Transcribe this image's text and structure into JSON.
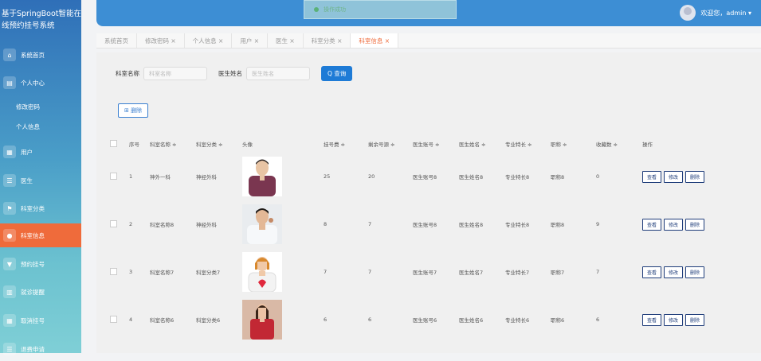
{
  "sidebar": {
    "brand": "基于SpringBoot智能在线预约挂号系统",
    "items": [
      {
        "label": "系统首页",
        "icon": "home-icon"
      },
      {
        "label": "个人中心",
        "icon": "user-card-icon"
      },
      {
        "label": "用户",
        "icon": "grid-icon"
      },
      {
        "label": "医生",
        "icon": "list-icon"
      },
      {
        "label": "科室分类",
        "icon": "flag-icon"
      },
      {
        "label": "科室信息",
        "icon": "pin-icon"
      },
      {
        "label": "预约挂号",
        "icon": "form-icon"
      },
      {
        "label": "就诊提醒",
        "icon": "chart-icon"
      },
      {
        "label": "取消挂号",
        "icon": "grid-icon"
      },
      {
        "label": "退费申请",
        "icon": "list-icon"
      }
    ],
    "subitems": [
      "修改密码",
      "个人信息"
    ]
  },
  "toast": {
    "text": "操作成功"
  },
  "header": {
    "welcome": "欢迎您，admin ▾"
  },
  "tabs": [
    "系统首页",
    "修改密码 ×",
    "个人信息 ×",
    "用户 ×",
    "医生 ×",
    "科室分类 ×",
    "科室信息 ×"
  ],
  "search": {
    "dept_label": "科室名称",
    "dept_placeholder": "科室名称",
    "doctor_label": "医生姓名",
    "doctor_placeholder": "医生姓名",
    "query_button": "Q 查询"
  },
  "delete_button": "⊞ 删除",
  "table": {
    "headers": [
      "序号",
      "科室名称 ≑",
      "科室分类 ≑",
      "头像",
      "挂号费 ≑",
      "剩余号源 ≑",
      "医生账号 ≑",
      "医生姓名 ≑",
      "专业特长 ≑",
      "职称 ≑",
      "收藏数 ≑",
      "操作"
    ],
    "rows": [
      {
        "no": "1",
        "dept": "神外一科",
        "category": "神经外科",
        "fee": "25",
        "remaining": "20",
        "account": "医生账号8",
        "name": "医生姓名8",
        "specialty": "专业特长8",
        "title": "职称8",
        "favorites": "0"
      },
      {
        "no": "2",
        "dept": "科室名称8",
        "category": "神经外科",
        "fee": "8",
        "remaining": "7",
        "account": "医生账号8",
        "name": "医生姓名8",
        "specialty": "专业特长8",
        "title": "职称8",
        "favorites": "9"
      },
      {
        "no": "3",
        "dept": "科室名称7",
        "category": "科室分类7",
        "fee": "7",
        "remaining": "7",
        "account": "医生账号7",
        "name": "医生姓名7",
        "specialty": "专业特长7",
        "title": "职称7",
        "favorites": "7"
      },
      {
        "no": "4",
        "dept": "科室名称6",
        "category": "科室分类6",
        "fee": "6",
        "remaining": "6",
        "account": "医生账号6",
        "name": "医生姓名6",
        "specialty": "专业特长6",
        "title": "职称6",
        "favorites": "6"
      }
    ],
    "actions": {
      "view": "查看",
      "edit": "修改",
      "delete": "删除"
    }
  }
}
